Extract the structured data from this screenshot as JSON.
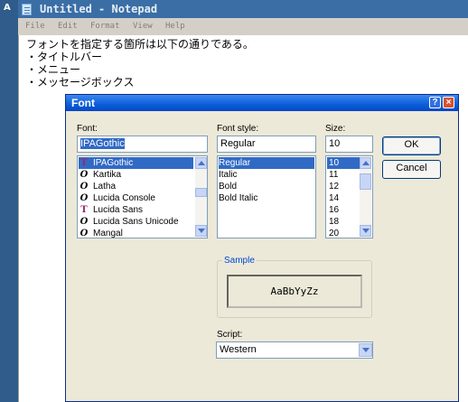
{
  "notepad": {
    "title": "Untitled - Notepad",
    "left_strip_letter": "A",
    "menu": [
      "File",
      "Edit",
      "Format",
      "View",
      "Help"
    ],
    "lines": [
      "フォントを指定する箇所は以下の通りである。",
      "・タイトルバー",
      "・メニュー",
      "・メッセージボックス"
    ]
  },
  "dialog": {
    "title": "Font",
    "help_glyph": "?",
    "close_glyph": "×",
    "font": {
      "label": "Font:",
      "value": "IPAGothic",
      "items": [
        {
          "name": "IPAGothic",
          "glyph": "T",
          "type": "truetype",
          "selected": true
        },
        {
          "name": "Kartika",
          "glyph": "O",
          "type": "opentype"
        },
        {
          "name": "Latha",
          "glyph": "O",
          "type": "opentype"
        },
        {
          "name": "Lucida Console",
          "glyph": "O",
          "type": "opentype"
        },
        {
          "name": "Lucida Sans",
          "glyph": "T",
          "type": "truetype"
        },
        {
          "name": "Lucida Sans Unicode",
          "glyph": "O",
          "type": "opentype"
        },
        {
          "name": "Mangal",
          "glyph": "O",
          "type": "opentype"
        }
      ]
    },
    "style": {
      "label": "Font style:",
      "value": "Regular",
      "items": [
        "Regular",
        "Italic",
        "Bold",
        "Bold Italic"
      ]
    },
    "size": {
      "label": "Size:",
      "value": "10",
      "items": [
        "10",
        "11",
        "12",
        "14",
        "16",
        "18",
        "20"
      ]
    },
    "ok_label": "OK",
    "cancel_label": "Cancel",
    "sample": {
      "label": "Sample",
      "text": "AaBbYyZz"
    },
    "script": {
      "label": "Script:",
      "value": "Western"
    }
  }
}
